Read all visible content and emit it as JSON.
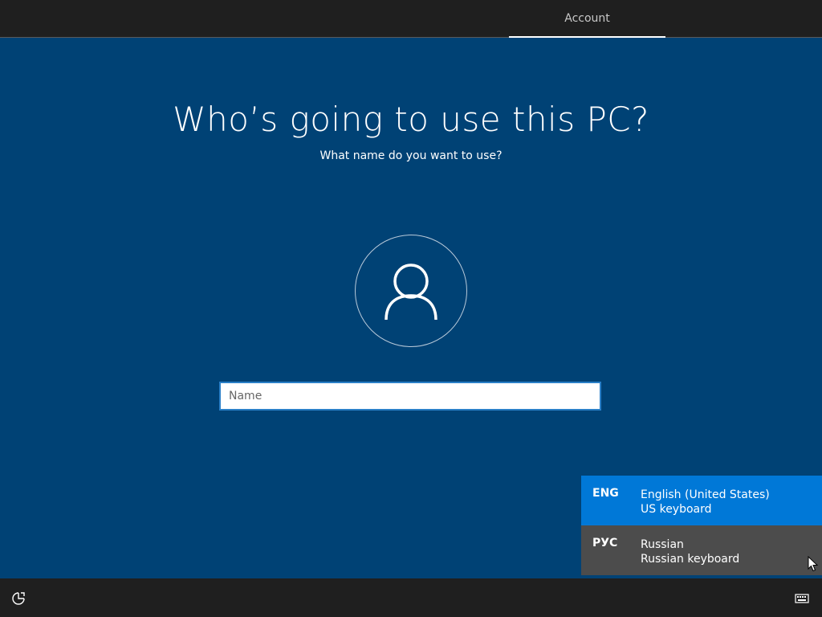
{
  "header": {
    "tab_account_label": "Account"
  },
  "main": {
    "title": "Who’s going to use this PC?",
    "subtitle": "What name do you want to use?",
    "avatar_icon": "user-icon",
    "name_input": {
      "value": "",
      "placeholder": "Name"
    }
  },
  "language_popup": {
    "items": [
      {
        "code": "ENG",
        "name": "English (United States)",
        "keyboard": "US keyboard",
        "selected": true
      },
      {
        "code": "РУС",
        "name": "Russian",
        "keyboard": "Russian keyboard",
        "selected": false
      }
    ]
  },
  "footer": {
    "accessibility_icon": "ease-of-access-icon",
    "keyboard_icon": "keyboard-icon"
  },
  "colors": {
    "background": "#004275",
    "accent": "#0078d7",
    "bar": "#1f1f1f",
    "popup_item": "#4c4c4c"
  }
}
